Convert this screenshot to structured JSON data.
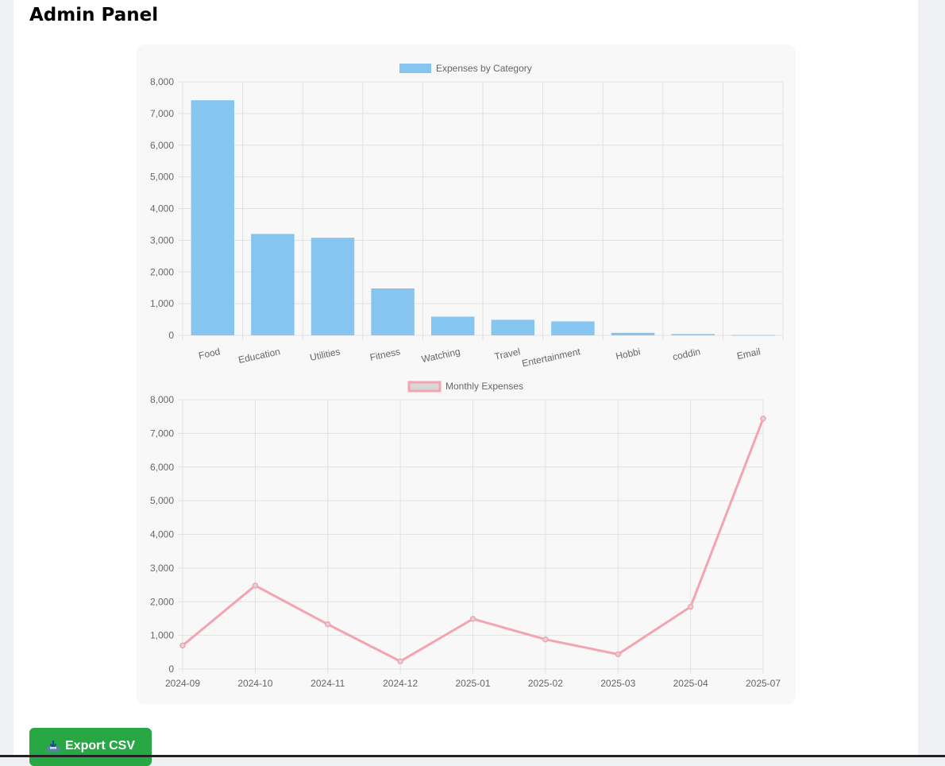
{
  "header": {
    "title": "Admin Panel"
  },
  "actions": {
    "export_label": "Export CSV",
    "export_icon": "inbox-tray-icon"
  },
  "colors": {
    "bar_fill": "#85c5f0",
    "line_stroke": "#f4a3b1",
    "legend_line_fill": "#d7d7d7",
    "grid": "#e2e2e2",
    "button": "#28a745"
  },
  "chart_data": [
    {
      "type": "bar",
      "legend": "Expenses by Category",
      "legend_position": "top",
      "categories": [
        "Food",
        "Education",
        "Utilities",
        "Fitness",
        "Watching",
        "Travel",
        "Entertainment",
        "Hobbi",
        "coddin",
        "Email"
      ],
      "values": [
        7420,
        3200,
        3080,
        1480,
        590,
        490,
        440,
        80,
        40,
        10
      ],
      "ylim": [
        0,
        8000
      ],
      "yticks": [
        "0",
        "1,000",
        "2,000",
        "3,000",
        "4,000",
        "5,000",
        "6,000",
        "7,000",
        "8,000"
      ],
      "grid": true
    },
    {
      "type": "line",
      "legend": "Monthly Expenses",
      "legend_position": "top",
      "categories": [
        "2024-09",
        "2024-10",
        "2024-11",
        "2024-12",
        "2025-01",
        "2025-02",
        "2025-03",
        "2025-04",
        "2025-07"
      ],
      "values": [
        700,
        2480,
        1330,
        230,
        1490,
        880,
        440,
        1850,
        7440
      ],
      "ylim": [
        0,
        8000
      ],
      "yticks": [
        "0",
        "1,000",
        "2,000",
        "3,000",
        "4,000",
        "5,000",
        "6,000",
        "7,000",
        "8,000"
      ],
      "grid": true
    }
  ]
}
